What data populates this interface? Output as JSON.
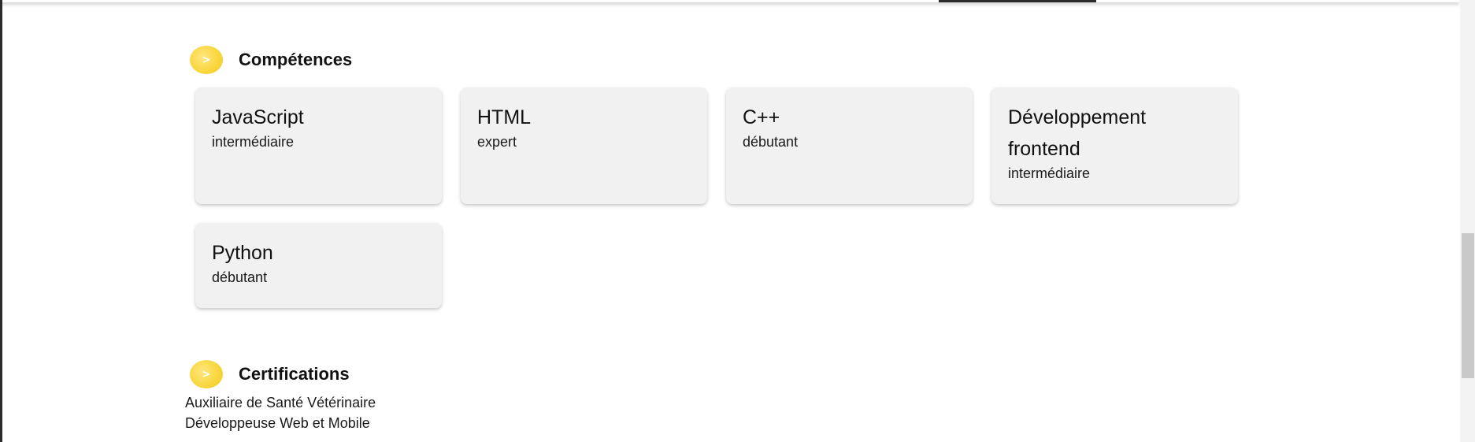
{
  "sections": {
    "skills": {
      "bullet": ">",
      "title": "Compétences",
      "cards": [
        {
          "name": "JavaScript",
          "level": "intermédiaire"
        },
        {
          "name": "HTML",
          "level": "expert"
        },
        {
          "name": "C++",
          "level": "débutant"
        },
        {
          "name": "Développement frontend",
          "level": "intermédiaire"
        },
        {
          "name": "Python",
          "level": "débutant"
        }
      ]
    },
    "certifications": {
      "bullet": ">",
      "title": "Certifications",
      "items": [
        "Auxiliaire de Santé Vétérinaire",
        "Développeuse Web et Mobile"
      ]
    }
  },
  "colors": {
    "accent": "#f8d63a",
    "card_bg": "#f1f1f1"
  },
  "icons": {
    "section_bullet": "chevron-right-icon"
  }
}
